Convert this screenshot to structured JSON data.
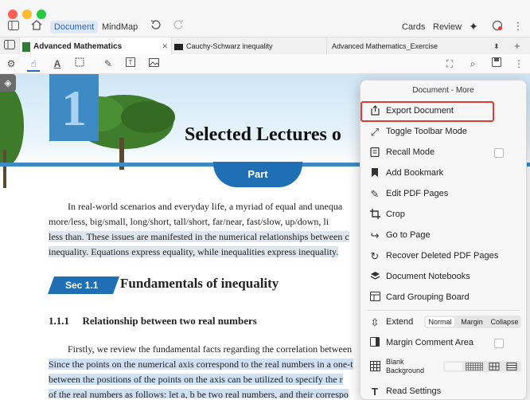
{
  "window": {
    "controls": {
      "close": "#ff5f57",
      "minimize": "#febc2e",
      "maximize": "#28c840"
    },
    "nav": {
      "document_label": "Document",
      "mindmap_label": "MindMap",
      "cards_label": "Cards",
      "review_label": "Review"
    }
  },
  "tabs": [
    {
      "label": "Advanced Mathematics",
      "active": true
    },
    {
      "label": "Cauchy-Schwarz inequality",
      "active": false
    },
    {
      "label": "Advanced Mathematics_Exercise",
      "active": false
    }
  ],
  "document": {
    "chapter_number": "1",
    "title": "Selected Lectures o",
    "part_label": "Part",
    "intro_lines": [
      "In real-world scenarios and everyday life, a myriad of equal and unequa",
      "more/less, big/small, long/short, tall/short, far/near, fast/slow, up/down, li",
      "less than.  These issues are manifested in the numerical relationships between c",
      "inequality.  Equations express equality, while inequalities express inequality."
    ],
    "section_badge": "Sec 1.1",
    "section_title": "Fundamentals of inequality",
    "subsection_number": "1.1.1",
    "subsection_title": "Relationship between two real numbers",
    "body_lines": [
      "Firstly, we review the fundamental facts regarding the correlation between",
      "Since the points on the numerical axis correspond to the real numbers in a one-t",
      "between the positions of the points on the axis can be utilized to specify the r",
      "of the real numbers as follows:  let a, b be two real numbers, and their correspo"
    ]
  },
  "menu": {
    "title": "Document - More",
    "items": [
      {
        "label": "Export Document",
        "icon": "export-icon"
      },
      {
        "label": "Toggle Toolbar Mode",
        "icon": "toggle-toolbar-icon"
      },
      {
        "label": "Recall Mode",
        "icon": "recall-icon"
      },
      {
        "label": "Add Bookmark",
        "icon": "bookmark-icon"
      },
      {
        "label": "Edit PDF Pages",
        "icon": "edit-pages-icon"
      },
      {
        "label": "Crop",
        "icon": "crop-icon"
      },
      {
        "label": "Go to Page",
        "icon": "goto-page-icon"
      },
      {
        "label": "Recover Deleted PDF Pages",
        "icon": "recover-icon"
      },
      {
        "label": "Document Notebooks",
        "icon": "notebooks-icon"
      },
      {
        "label": "Card Grouping Board",
        "icon": "card-board-icon"
      }
    ],
    "extend": {
      "label": "Extend",
      "options": [
        "Normal",
        "Margin",
        "Collapse"
      ],
      "selected": "Normal"
    },
    "margin_comment": "Margin Comment Area",
    "blank_background_line1": "Blank",
    "blank_background_line2": "Background",
    "read_settings": "Read Settings"
  }
}
